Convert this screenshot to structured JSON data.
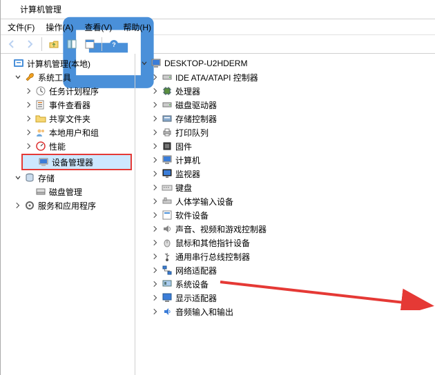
{
  "window": {
    "title": "计算机管理"
  },
  "menu": {
    "file": "文件(F)",
    "action": "操作(A)",
    "view": "查看(V)",
    "help": "帮助(H)"
  },
  "toolbar": {
    "back": "后退",
    "forward": "前进",
    "up": "上移",
    "show_hide": "显示/隐藏控制台树",
    "properties": "属性",
    "help_btn": "帮助"
  },
  "left_tree": {
    "root": "计算机管理(本地)",
    "system_tools": "系统工具",
    "task_scheduler": "任务计划程序",
    "event_viewer": "事件查看器",
    "shared_folders": "共享文件夹",
    "local_users": "本地用户和组",
    "performance": "性能",
    "device_manager": "设备管理器",
    "storage": "存储",
    "disk_mgmt": "磁盘管理",
    "services_apps": "服务和应用程序"
  },
  "right_tree": {
    "root": "DESKTOP-U2HDERM",
    "ide": "IDE ATA/ATAPI 控制器",
    "cpu": "处理器",
    "disk_drive": "磁盘驱动器",
    "storage_ctrl": "存储控制器",
    "print_queue": "打印队列",
    "firmware": "固件",
    "computer": "计算机",
    "monitor": "监视器",
    "keyboard": "键盘",
    "hid": "人体学输入设备",
    "software_dev": "软件设备",
    "sound": "声音、视频和游戏控制器",
    "mouse": "鼠标和其他指针设备",
    "usb": "通用串行总线控制器",
    "network": "网络适配器",
    "system_dev": "系统设备",
    "display": "显示适配器",
    "audio_io": "音频输入和输出"
  }
}
